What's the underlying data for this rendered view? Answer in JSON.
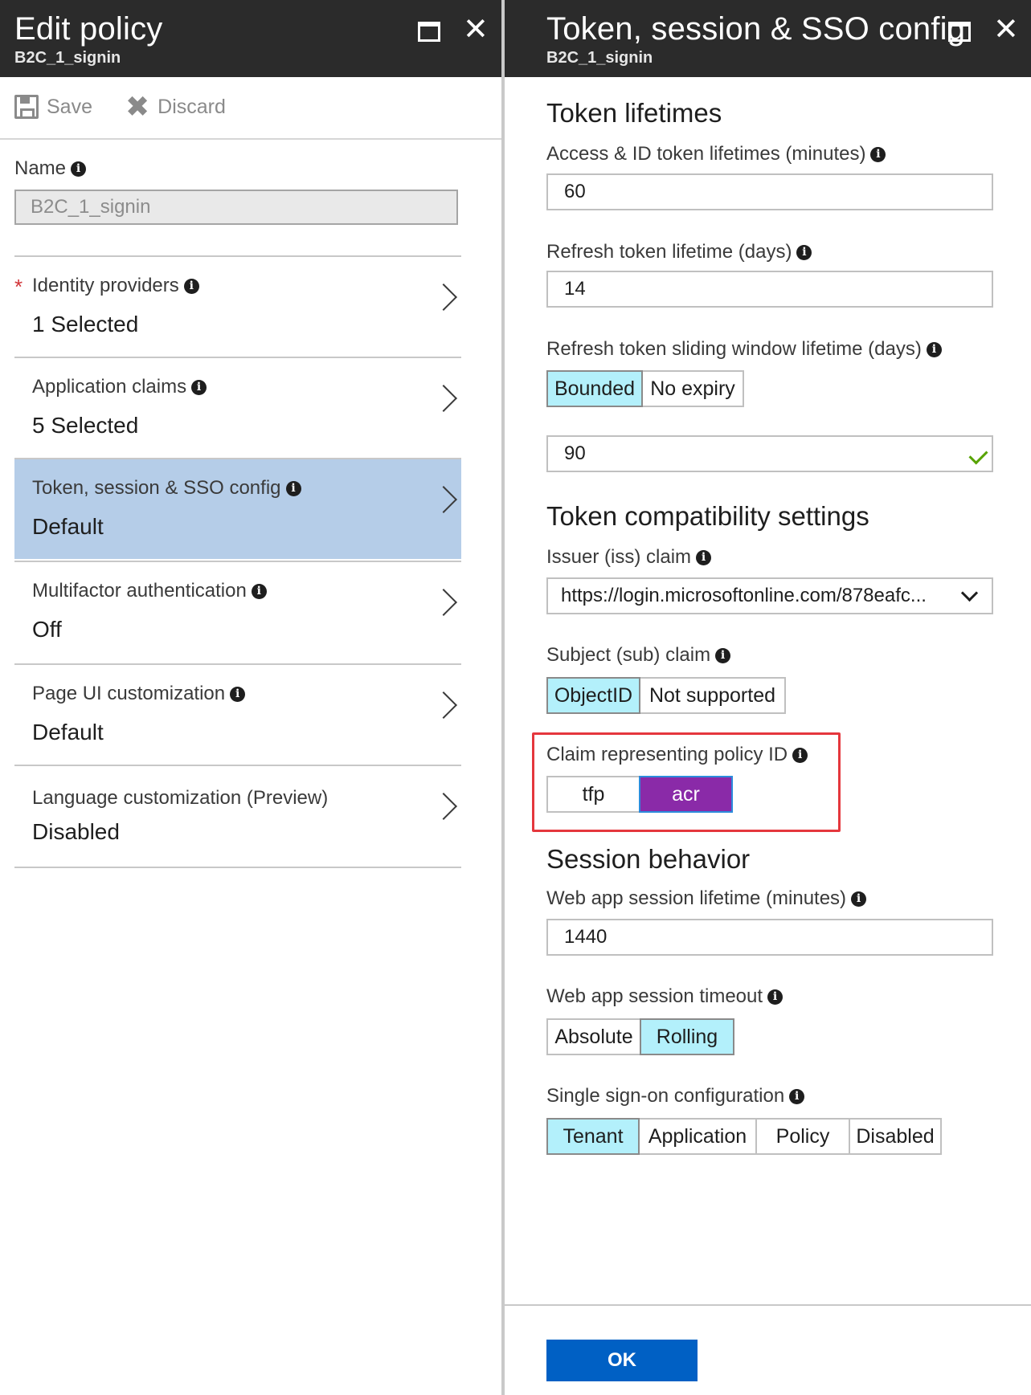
{
  "left_blade": {
    "title": "Edit policy",
    "subtitle": "B2C_1_signin",
    "toolbar": {
      "save_label": "Save",
      "discard_label": "Discard"
    },
    "name_label": "Name",
    "name_value": "B2C_1_signin",
    "nav_items": [
      {
        "title": "Identity providers",
        "value": "1 Selected",
        "required": true,
        "selected": false
      },
      {
        "title": "Application claims",
        "value": "5 Selected",
        "required": false,
        "selected": false
      },
      {
        "title": "Token, session & SSO config",
        "value": "Default",
        "required": false,
        "selected": true
      },
      {
        "title": "Multifactor authentication",
        "value": "Off",
        "required": false,
        "selected": false
      },
      {
        "title": "Page UI customization",
        "value": "Default",
        "required": false,
        "selected": false
      },
      {
        "title": "Language customization (Preview)",
        "value": "Disabled",
        "required": false,
        "selected": false
      }
    ],
    "required_marker": "*"
  },
  "right_blade": {
    "title": "Token, session & SSO config",
    "subtitle": "B2C_1_signin",
    "token_lifetimes": {
      "heading": "Token lifetimes",
      "access_label": "Access & ID token lifetimes (minutes)",
      "access_value": "60",
      "refresh_label": "Refresh token lifetime (days)",
      "refresh_value": "14",
      "sliding_label": "Refresh token sliding window lifetime (days)",
      "sliding_options": [
        "Bounded",
        "No expiry"
      ],
      "sliding_selected": "Bounded",
      "sliding_value": "90"
    },
    "compat": {
      "heading": "Token compatibility settings",
      "issuer_label": "Issuer (iss) claim",
      "issuer_value": "https://login.microsoftonline.com/878eafc...",
      "subject_label": "Subject (sub) claim",
      "subject_options": [
        "ObjectID",
        "Not supported"
      ],
      "subject_selected": "ObjectID",
      "policy_claim_label": "Claim representing policy ID",
      "policy_claim_options": [
        "tfp",
        "acr"
      ],
      "policy_claim_selected": "acr"
    },
    "session": {
      "heading": "Session behavior",
      "lifetime_label": "Web app session lifetime (minutes)",
      "lifetime_value": "1440",
      "timeout_label": "Web app session timeout",
      "timeout_options": [
        "Absolute",
        "Rolling"
      ],
      "timeout_selected": "Rolling",
      "sso_label": "Single sign-on configuration",
      "sso_options": [
        "Tenant",
        "Application",
        "Policy",
        "Disabled"
      ],
      "sso_selected": "Tenant"
    },
    "ok_label": "OK"
  },
  "icons": {
    "info": "info-icon",
    "info_glyph": "i",
    "close_glyph": "✕",
    "discard_glyph": "✖"
  },
  "colors": {
    "header_bg": "#2b2b2b",
    "selected_nav": "#b5cde8",
    "toggle_on": "#b3f0fb",
    "toggle_purple": "#8a2aa8",
    "highlight_red": "#e5373d",
    "ok_blue": "#0060c4"
  }
}
